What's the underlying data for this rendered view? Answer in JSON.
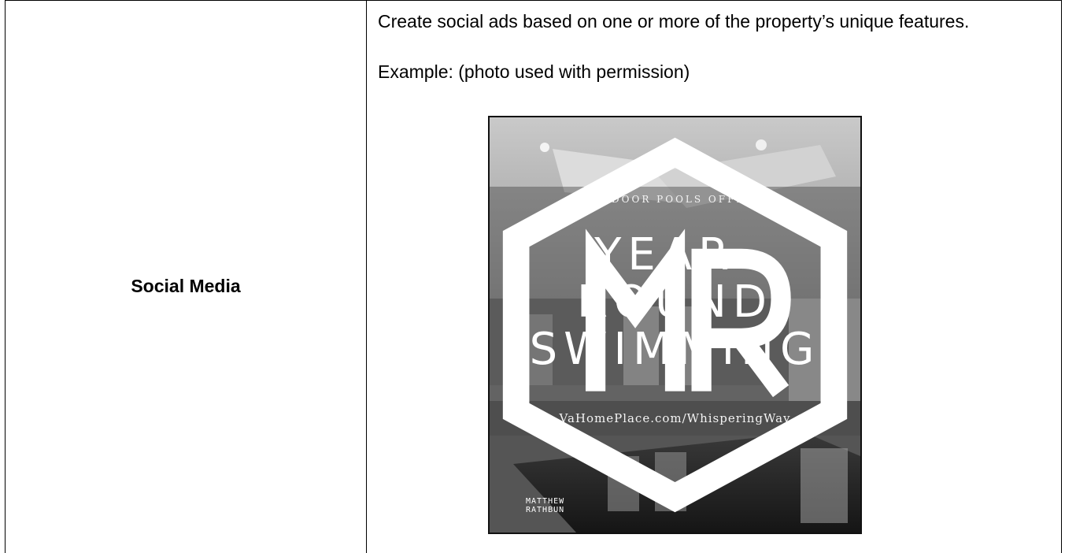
{
  "row": {
    "label": "Social Media",
    "description": "Create social ads based on one or more of the property’s unique features.",
    "example_caption": "Example: (photo used with permission)"
  },
  "ad": {
    "kicker": "INDOOR POOLS OFFER",
    "headline_line1": "YEAR-",
    "headline_line2": "ROUND",
    "headline_line3": "SWIMMING",
    "url": "VaHomePlace.com/WhisperingWay",
    "logo_line1": "MATTHEW",
    "logo_line2": "RATHBUN",
    "logo_icon": "mr-monogram-icon"
  }
}
